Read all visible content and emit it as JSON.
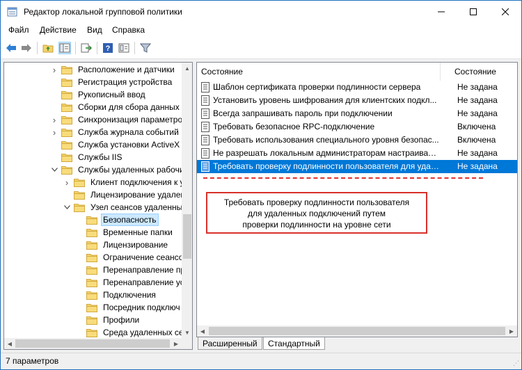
{
  "window": {
    "title": "Редактор локальной групповой политики"
  },
  "menu": [
    "Файл",
    "Действие",
    "Вид",
    "Справка"
  ],
  "toolbar": {
    "icons": [
      "back-arrow-icon",
      "forward-arrow-icon",
      "up-folder-icon",
      "show-hide-tree-icon",
      "export-list-icon",
      "help-icon",
      "extended-view-icon",
      "filter-icon"
    ]
  },
  "tree": {
    "items": [
      {
        "label": "Расположение и датчики",
        "indent": 1,
        "chevron": "collapsed"
      },
      {
        "label": "Регистрация устройства",
        "indent": 1,
        "chevron": "none"
      },
      {
        "label": "Рукописный ввод",
        "indent": 1,
        "chevron": "none"
      },
      {
        "label": "Сборки для сбора данных и",
        "indent": 1,
        "chevron": "none"
      },
      {
        "label": "Синхронизация параметров",
        "indent": 1,
        "chevron": "collapsed"
      },
      {
        "label": "Служба журнала событий",
        "indent": 1,
        "chevron": "collapsed"
      },
      {
        "label": "Служба установки ActiveX",
        "indent": 1,
        "chevron": "none"
      },
      {
        "label": "Службы IIS",
        "indent": 1,
        "chevron": "none"
      },
      {
        "label": "Службы удаленных рабочи",
        "indent": 1,
        "chevron": "expanded"
      },
      {
        "label": "Клиент подключения к у",
        "indent": 2,
        "chevron": "collapsed"
      },
      {
        "label": "Лицензирование удален",
        "indent": 2,
        "chevron": "none"
      },
      {
        "label": "Узел сеансов удаленных",
        "indent": 2,
        "chevron": "expanded"
      },
      {
        "label": "Безопасность",
        "indent": 3,
        "chevron": "none",
        "selected": true
      },
      {
        "label": "Временные папки",
        "indent": 3,
        "chevron": "none"
      },
      {
        "label": "Лицензирование",
        "indent": 3,
        "chevron": "none"
      },
      {
        "label": "Ограничение сеансов",
        "indent": 3,
        "chevron": "none"
      },
      {
        "label": "Перенаправление пр",
        "indent": 3,
        "chevron": "none"
      },
      {
        "label": "Перенаправление ус",
        "indent": 3,
        "chevron": "none"
      },
      {
        "label": "Подключения",
        "indent": 3,
        "chevron": "none"
      },
      {
        "label": "Посредник подключ",
        "indent": 3,
        "chevron": "none"
      },
      {
        "label": "Профили",
        "indent": 3,
        "chevron": "none"
      },
      {
        "label": "Среда удаленных се",
        "indent": 3,
        "chevron": "none"
      }
    ]
  },
  "list": {
    "header_name": "Состояние",
    "header_state": "Состояние",
    "rows": [
      {
        "name": "Шаблон сертификата проверки подлинности сервера",
        "state": "Не задана"
      },
      {
        "name": "Установить уровень шифрования для клиентских подкл...",
        "state": "Не задана"
      },
      {
        "name": "Всегда запрашивать пароль при подключении",
        "state": "Не задана"
      },
      {
        "name": "Требовать безопасное RPC-подключение",
        "state": "Включена"
      },
      {
        "name": "Требовать использования специального уровня безопас...",
        "state": "Включена"
      },
      {
        "name": "Не разрешать локальным администраторам настраивать...",
        "state": "Не задана"
      },
      {
        "name": "Требовать проверку подлинности пользователя для удал...",
        "state": "Не задана",
        "selected": true
      }
    ]
  },
  "callout": {
    "line1": "Требовать проверку подлинности пользователя",
    "line2": "для удаленных подключений путем",
    "line3": "проверки подлинности на уровне сети"
  },
  "tabs": {
    "extended": "Расширенный",
    "standard": "Стандартный"
  },
  "status": {
    "text": "7 параметров"
  },
  "colors": {
    "selection": "#0078d7",
    "tree_selection": "#cce8ff",
    "callout_border": "#d9302b",
    "folder": "#f5d36b"
  }
}
